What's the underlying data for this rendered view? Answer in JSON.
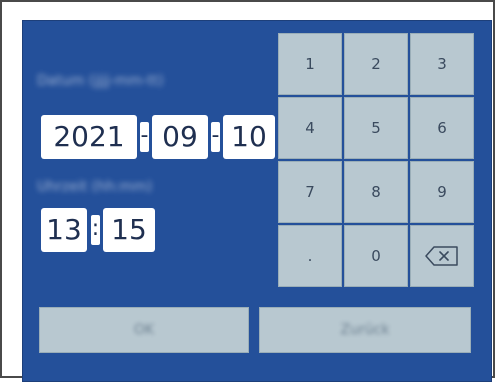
{
  "date_label": "Datum (jjjj-mm-tt)",
  "time_label": "Uhrzeit (hh:mm)",
  "date": {
    "year": "2021",
    "month": "09",
    "day": "10",
    "separator": "-"
  },
  "time": {
    "hour": "13",
    "minute": "15",
    "separator": ":"
  },
  "keypad": {
    "keys": [
      "1",
      "2",
      "3",
      "4",
      "5",
      "6",
      "7",
      "8",
      "9",
      ".",
      "0"
    ],
    "backspace_icon": "backspace-icon"
  },
  "buttons": {
    "ok": "OK",
    "back": "Zurück"
  },
  "colors": {
    "background": "#24509a",
    "key": "#b8c8d0",
    "field": "#ffffff",
    "text": "#1f2f50"
  }
}
